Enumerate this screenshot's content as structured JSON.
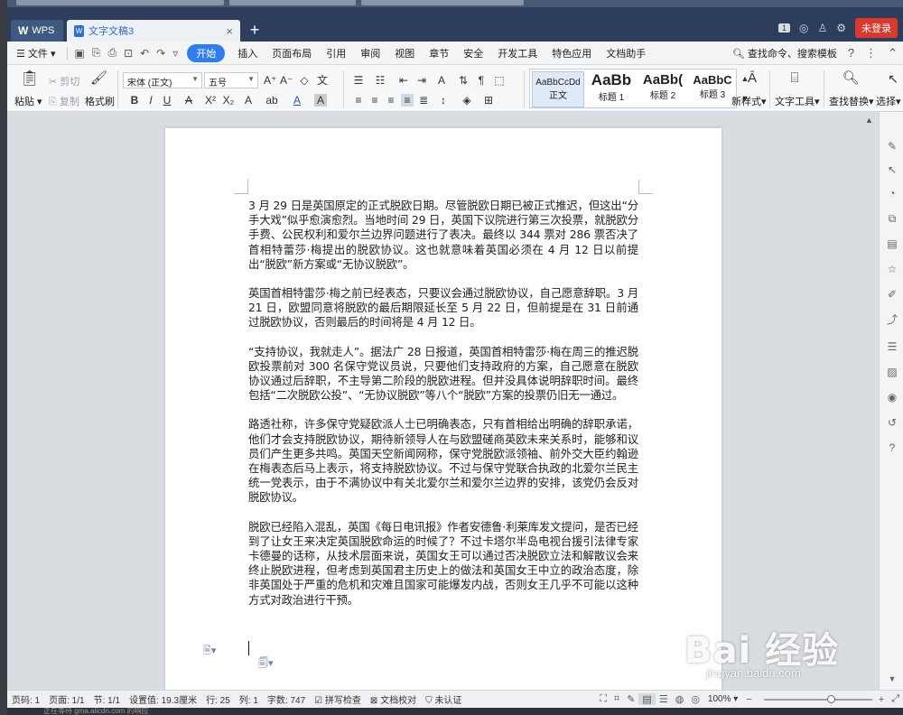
{
  "titlebar": {
    "app_tab": "WPS",
    "doc_tab": "文字文稿3",
    "add_tab": "+",
    "page_badge": "1",
    "login": "未登录"
  },
  "menubar": {
    "file": "文件",
    "items": [
      "开始",
      "插入",
      "页面布局",
      "引用",
      "审阅",
      "视图",
      "章节",
      "安全",
      "开发工具",
      "特色应用",
      "文档助手"
    ],
    "active_index": 0,
    "search": "查找命令、搜索模板",
    "help": "?"
  },
  "ribbon": {
    "paste": "粘贴",
    "cut": "剪切",
    "copy": "复制",
    "format_painter": "格式刷",
    "font_name": "宋体 (正文)",
    "font_size": "五号",
    "styles": [
      {
        "preview": "AaBbCcDd",
        "label": "正文"
      },
      {
        "preview": "AaBb",
        "label": "标题 1"
      },
      {
        "preview": "AaBb(",
        "label": "标题 2"
      },
      {
        "preview": "AaBbC",
        "label": "标题 3"
      }
    ],
    "new_style": "新样式",
    "text_tools": "文字工具",
    "find_replace": "查找替换",
    "select": "选择"
  },
  "document": {
    "paragraphs": [
      "3 月 29 日是英国原定的正式脱欧日期。尽管脱欧日期已被正式推迟，但这出“分手大戏”似乎愈演愈烈。当地时间 29 日，英国下议院进行第三次投票，就脱欧分手费、公民权利和爱尔兰边界问题进行了表决。最终以 344 票对 286 票否决了首相特蕾莎·梅提出的脱欧协议。这也就意味着英国必须在 4 月 12 日以前提出“脱欧”新方案或“无协议脱欧”。",
      "英国首相特雷莎·梅之前已经表态，只要议会通过脱欧协议，自己愿意辞职。3 月 21 日，欧盟同意将脱欧的最后期限延长至 5 月 22 日，但前提是在 31 日前通过脱欧协议，否则最后的时间将是 4 月 12 日。",
      "“支持协议，我就走人”。据法广 28 日报道，英国首相特雷莎·梅在周三的推迟脱欧投票前对 300 名保守党议员说，只要他们支持政府的方案，自己愿意在脱欧协议通过后辞职，不主导第二阶段的脱欧进程。但并没具体说明辞职时间。最终包括“二次脱欧公投”、“无协议脱欧”等八个“脱欧”方案的投票仍旧无一通过。",
      "路透社称，许多保守党疑欧派人士已明确表态，只有首相给出明确的辞职承诺，他们才会支持脱欧协议，期待新领导人在与欧盟磋商英欧未来关系时，能够和议员们产生更多共鸣。英国天空新闻网称，保守党脱欧派领袖、前外交大臣约翰逊在梅表态后马上表示，将支持脱欧协议。不过与保守党联合执政的北爱尔兰民主统一党表示，由于不满协议中有关北爱尔兰和爱尔兰边界的安排，该党仍会反对脱欧协议。",
      "脱欧已经陷入混乱，英国《每日电讯报》作者安德鲁·利莱库发文提问，是否已经到了让女王来决定英国脱欧命运的时候了？不过卡塔尔半岛电视台援引法律专家卡德曼的话称，从技术层面来说，英国女王可以通过否决脱欧立法和解散议会来终止脱欧进程，但考虑到英国君主历史上的做法和英国女王中立的政治态度，除非英国处于严重的危机和灾难且国家可能爆发内战，否则女王几乎不可能以这种方式对政治进行干预。"
    ]
  },
  "statusbar": {
    "page_num": "页码: 1",
    "pages": "页面: 1/1",
    "section": "节: 1/1",
    "setting": "设置值: 19.3厘米",
    "row": "行: 25",
    "col": "列: 1",
    "words": "字数: 747",
    "spell": "拼写检查",
    "proof": "文档校对",
    "auth": "未认证",
    "zoom": "100%"
  },
  "watermark": {
    "main": "Bai 经验",
    "sub": "jingyan.baidu.com"
  },
  "bottom_strip": "正在等待 gma.alicdn.com 的响应"
}
